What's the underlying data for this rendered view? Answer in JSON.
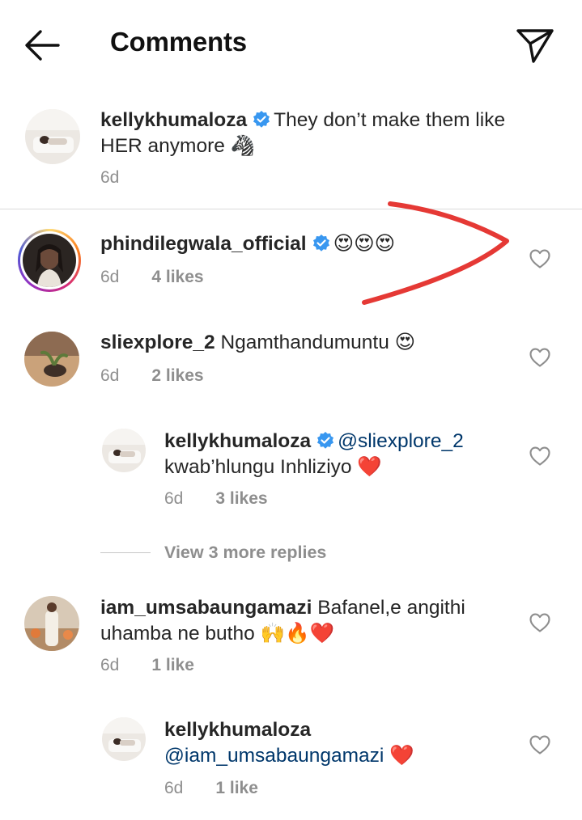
{
  "header": {
    "title": "Comments",
    "back_icon": "arrow-left-icon",
    "share_icon": "paper-plane-icon"
  },
  "caption": {
    "username": "kellykhumaloza",
    "verified": true,
    "text": "They don’t make them like HER anymore",
    "emoji": "🦓",
    "time": "6d"
  },
  "comments": [
    {
      "username": "phindilegwala_official",
      "verified": true,
      "text": "",
      "emoji": "😍😍😍",
      "time": "6d",
      "likes": "4 likes",
      "has_story": true
    },
    {
      "username": "sliexplore_2",
      "verified": false,
      "text": "Ngamthandumuntu",
      "emoji": "😍",
      "time": "6d",
      "likes": "2 likes"
    },
    {
      "username": "kellykhumaloza",
      "verified": true,
      "mention": "@sliexplore_2",
      "text": "kwab’hlungu Inhliziyo",
      "emoji": "❤️",
      "time": "6d",
      "likes": "3 likes",
      "is_reply": true
    },
    {
      "username": "iam_umsabaungamazi",
      "verified": false,
      "text": "Bafanel,e angithi uhamba ne butho",
      "emoji": "🙌🔥❤️",
      "time": "6d",
      "likes": "1 like"
    },
    {
      "username": "kellykhumaloza",
      "verified": false,
      "mention": "@iam_umsabaungamazi",
      "emoji": "❤️",
      "time": "6d",
      "likes": "1 like",
      "is_reply": true
    }
  ],
  "view_replies_label": "View 3 more replies",
  "colors": {
    "verified_blue": "#3897f0",
    "mention_blue": "#00376b",
    "meta_gray": "#8e8e8e",
    "annotation_red": "#e53935"
  }
}
